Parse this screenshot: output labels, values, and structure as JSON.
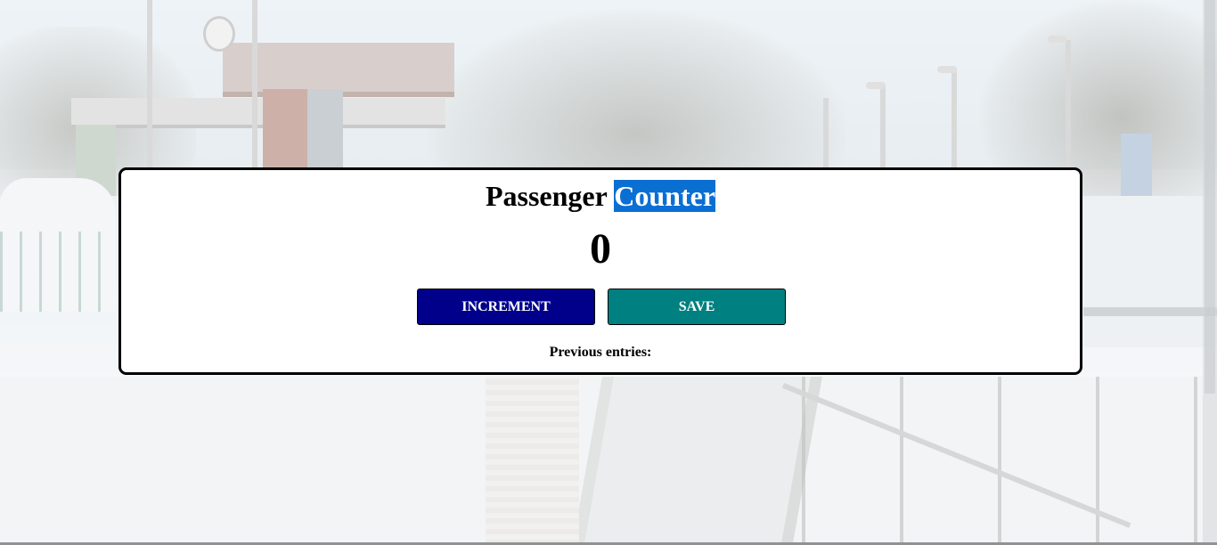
{
  "counter_app": {
    "title_word_1": "Passenger",
    "title_word_2": "Counter",
    "count": "0",
    "increment_label": "INCREMENT",
    "save_label": "SAVE",
    "previous_entries_label": "Previous entries:"
  },
  "colors": {
    "increment_button": "#00008b",
    "save_button": "#008080",
    "selection_highlight": "#0a6fd3"
  }
}
